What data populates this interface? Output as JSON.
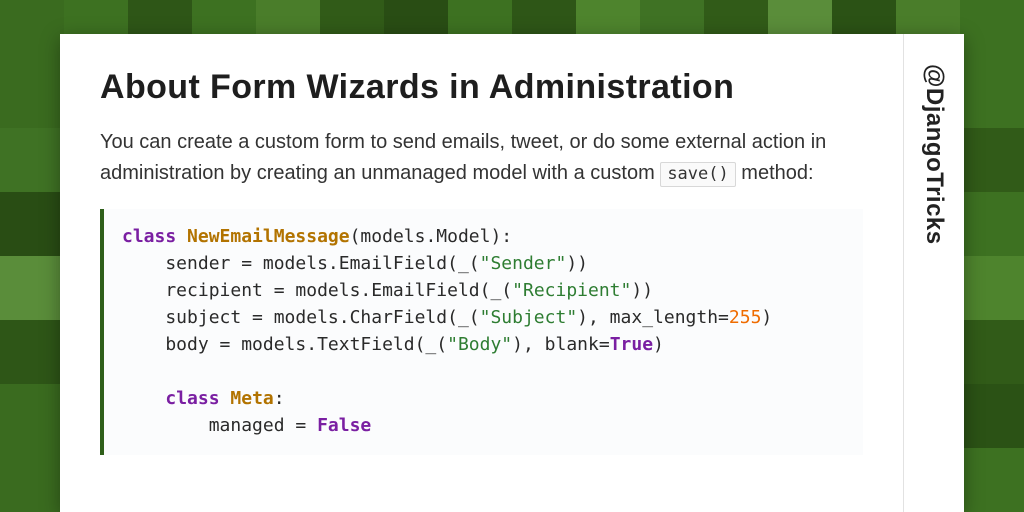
{
  "handle": "@DjangoTricks",
  "title": "About Form Wizards in Administration",
  "lead_parts": {
    "before": "You can create a custom form to send emails, tweet, or do some external action in administration by creating an unmanaged model with a custom ",
    "code": "save()",
    "after": " method:"
  },
  "code": {
    "kw_class": "class",
    "name_main": "NewEmailMessage",
    "after_main_name": "(models.Model):",
    "line_sender_a": "    sender = models.EmailField(_(",
    "str_sender": "\"Sender\"",
    "line_sender_b": "))",
    "line_recipient_a": "    recipient = models.EmailField(_(",
    "str_recipient": "\"Recipient\"",
    "line_recipient_b": "))",
    "line_subject_a": "    subject = models.CharField(_(",
    "str_subject": "\"Subject\"",
    "line_subject_b": "), max_length=",
    "num_255": "255",
    "line_subject_c": ")",
    "line_body_a": "    body = models.TextField(_(",
    "str_body": "\"Body\"",
    "line_body_b": "), blank=",
    "bool_true": "True",
    "line_body_c": ")",
    "meta_indent": "    ",
    "name_meta": "Meta",
    "after_meta": ":",
    "line_managed_a": "        managed = ",
    "bool_false": "False"
  }
}
